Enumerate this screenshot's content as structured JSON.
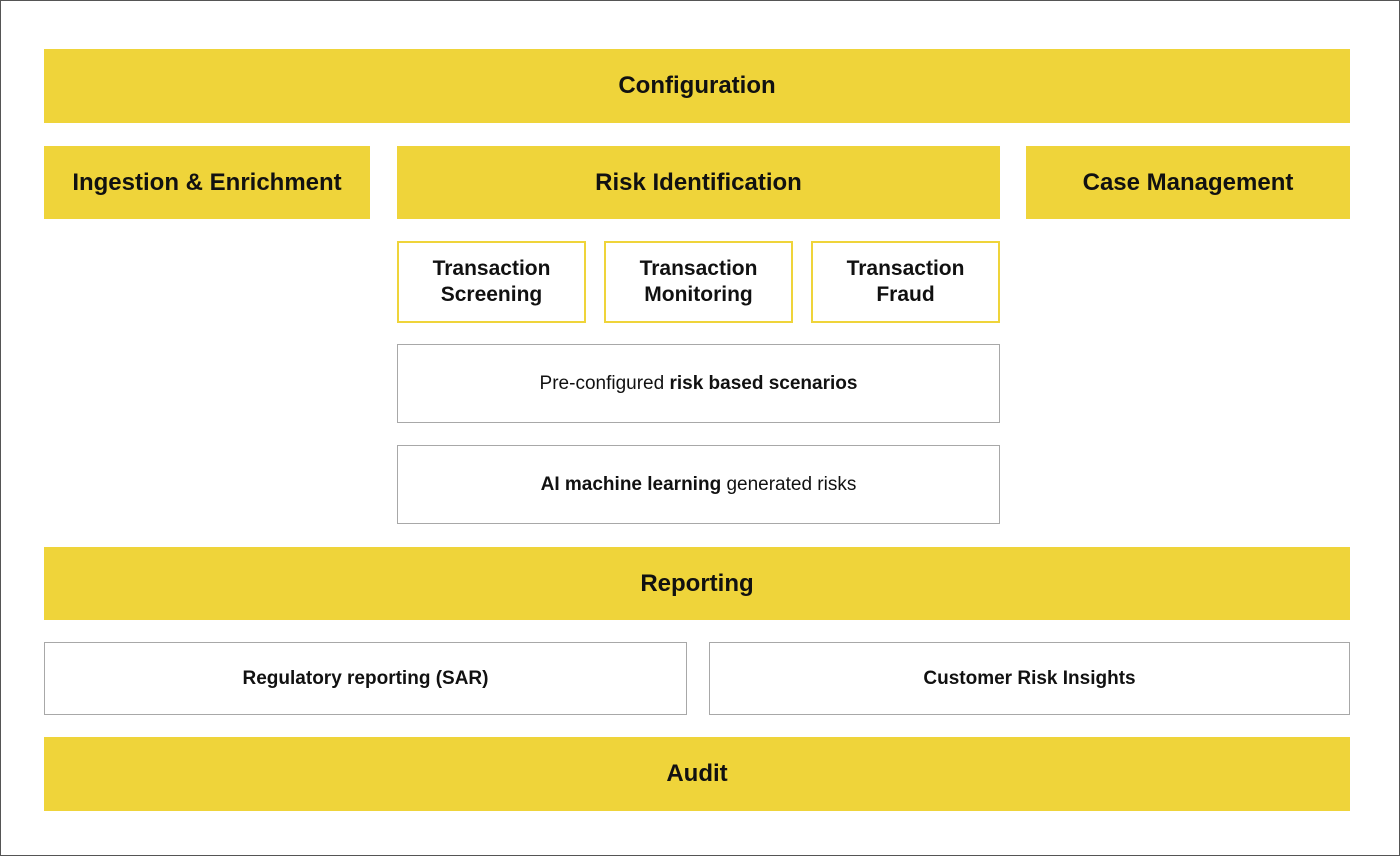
{
  "colors": {
    "accent": "#efd43a",
    "border_gray": "#a8a8a8"
  },
  "configuration": "Configuration",
  "ingestion": "Ingestion & Enrichment",
  "risk_identification": "Risk Identification",
  "case_management": "Case Management",
  "transaction_boxes": [
    {
      "line1": "Transaction",
      "line2": "Screening"
    },
    {
      "line1": "Transaction",
      "line2": "Monitoring"
    },
    {
      "line1": "Transaction",
      "line2": "Fraud"
    }
  ],
  "scenarios": {
    "prefix": "Pre-configured ",
    "bold": "risk based scenarios"
  },
  "ai": {
    "bold": "AI machine learning",
    "suffix": " generated risks"
  },
  "reporting": "Reporting",
  "regulatory": "Regulatory reporting (SAR)",
  "insights": "Customer Risk Insights",
  "audit": "Audit"
}
